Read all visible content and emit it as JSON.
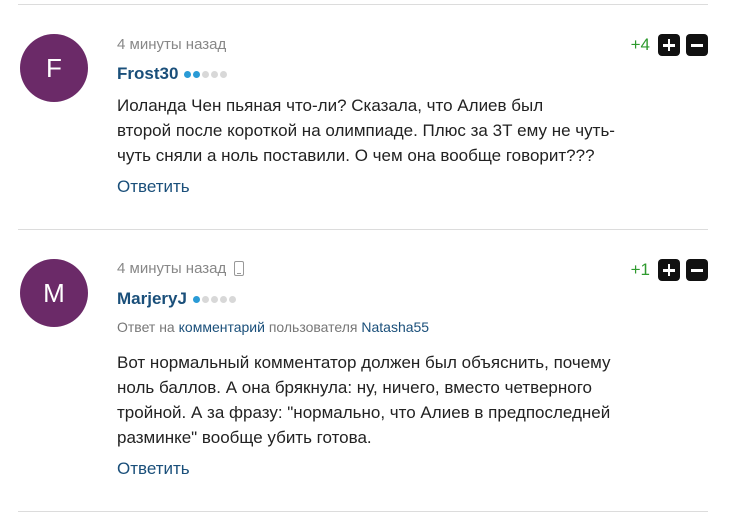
{
  "comments": [
    {
      "avatar_letter": "F",
      "time": "4 минуты назад",
      "author": "Frost30",
      "rating": "+4",
      "text_lines": [
        "Иоланда Чен пьяная что-ли? Сказала, что Алиев был",
        "второй после короткой на олимпиаде. Плюс за 3Т ему не чуть-",
        "чуть сняли а ноль поставили. О чем она вообще говорит???"
      ],
      "reply_label": "Ответить"
    },
    {
      "avatar_letter": "M",
      "time": "4 минуты назад",
      "author": "MarjeryJ",
      "rating": "+1",
      "reply_to": {
        "prefix": "Ответ на",
        "link": "комментарий",
        "middle": "пользователя",
        "user": "Natasha55"
      },
      "text_lines": [
        "Вот нормальный комментатор должен был объяснить, почему",
        "ноль баллов. А она брякнула: ну, ничего, вместо четверного",
        "тройной. А за фразу: \"нормально, что Алиев в предпоследней",
        "разминке\" вообще убить готова."
      ],
      "reply_label": "Ответить"
    }
  ],
  "colors": {
    "avatar_bg": "#6b2a68",
    "author": "#1a4f7a",
    "rating_positive": "#2e9a2e",
    "level_dot_active": "#2a9bd6"
  }
}
